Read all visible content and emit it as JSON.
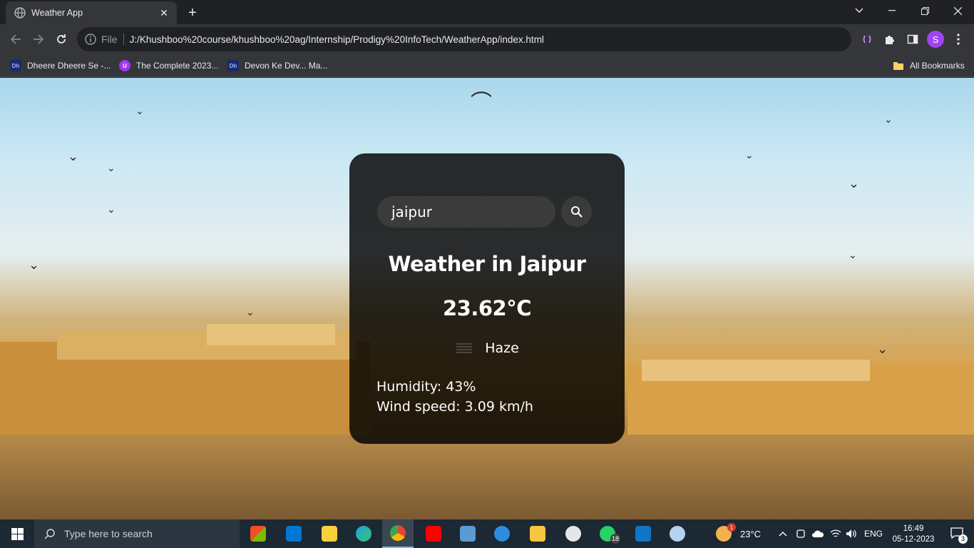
{
  "browser": {
    "tab_title": "Weather App",
    "new_tab_label": "+",
    "url_scheme": "File",
    "url": "J:/Khushboo%20course/khushboo%20ag/Internship/Prodigy%20InfoTech/WeatherApp/index.html",
    "profile_initial": "S"
  },
  "bookmarks": {
    "items": [
      {
        "label": "Dheere Dheere Se -..."
      },
      {
        "label": "The Complete 2023..."
      },
      {
        "label": "Devon Ke Dev... Ma..."
      }
    ],
    "all_bookmarks": "All Bookmarks"
  },
  "weather": {
    "search_value": "jaipur",
    "city_heading": "Weather in Jaipur",
    "temperature": "23.62°C",
    "condition": "Haze",
    "humidity": "Humidity: 43%",
    "wind": "Wind speed: 3.09 km/h"
  },
  "taskbar": {
    "search_placeholder": "Type here to search",
    "whatsapp_badge": "18",
    "weather_temp": "23°C",
    "weather_badge": "1",
    "language": "ENG",
    "time": "16:49",
    "date": "05-12-2023",
    "notifications": "3"
  },
  "colors": {
    "card_bg": "#000000",
    "input_bg": "#3b3b3b",
    "chrome_bg": "#202124",
    "toolbar_bg": "#35363a",
    "profile": "#a142f4"
  }
}
